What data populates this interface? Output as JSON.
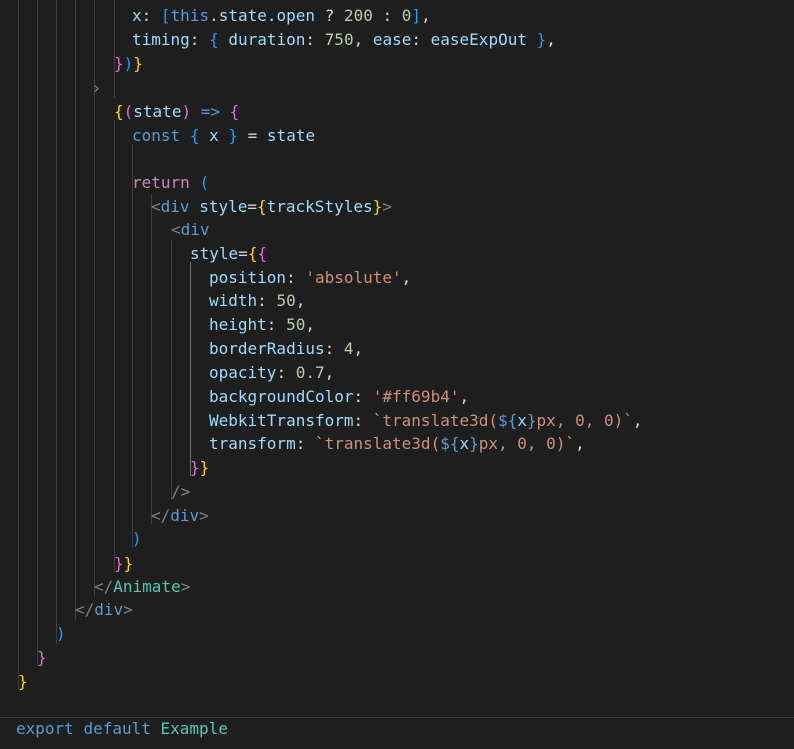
{
  "editor": {
    "language": "javascript-react",
    "theme_colors": {
      "background": "#1e1e1e",
      "default": "#d4d4d4",
      "variable": "#9cdcfe",
      "keyword": "#569cd6",
      "control": "#c586c0",
      "number": "#b5cea8",
      "string": "#ce9178",
      "component": "#4ec9b0",
      "bracket_gold": "#ffd700",
      "bracket_orchid": "#da70d6",
      "bracket_blue": "#179fff"
    },
    "fold_marker": "›",
    "lines": [
      {
        "tokens": [
          [
            "t-var",
            "x"
          ],
          [
            "t-default",
            ": "
          ],
          [
            "t-b3",
            "["
          ],
          [
            "t-kw",
            "this"
          ],
          [
            "t-default",
            "."
          ],
          [
            "t-var",
            "state"
          ],
          [
            "t-default",
            "."
          ],
          [
            "t-var",
            "open"
          ],
          [
            "t-default",
            " ? "
          ],
          [
            "t-num",
            "200"
          ],
          [
            "t-default",
            " : "
          ],
          [
            "t-num",
            "0"
          ],
          [
            "t-b3",
            "]"
          ],
          [
            "t-default",
            ","
          ]
        ]
      },
      {
        "tokens": [
          [
            "t-var",
            "timing"
          ],
          [
            "t-default",
            ": "
          ],
          [
            "t-b3",
            "{"
          ],
          [
            "t-default",
            " "
          ],
          [
            "t-var",
            "duration"
          ],
          [
            "t-default",
            ": "
          ],
          [
            "t-num",
            "750"
          ],
          [
            "t-default",
            ", "
          ],
          [
            "t-var",
            "ease"
          ],
          [
            "t-default",
            ": "
          ],
          [
            "t-var",
            "easeExpOut"
          ],
          [
            "t-default",
            " "
          ],
          [
            "t-b3",
            "}"
          ],
          [
            "t-default",
            ","
          ]
        ]
      },
      {
        "tokens": [
          [
            "t-b2",
            "}"
          ],
          [
            "t-b3",
            ")"
          ],
          [
            "t-b1",
            "}"
          ]
        ]
      },
      {
        "tokens": []
      },
      {
        "tokens": [
          [
            "t-b1",
            "{"
          ],
          [
            "t-b2",
            "("
          ],
          [
            "t-var",
            "state"
          ],
          [
            "t-b2",
            ")"
          ],
          [
            "t-default",
            " "
          ],
          [
            "t-kw",
            "=>"
          ],
          [
            "t-default",
            " "
          ],
          [
            "t-b2",
            "{"
          ]
        ]
      },
      {
        "tokens": [
          [
            "t-kw",
            "const"
          ],
          [
            "t-default",
            " "
          ],
          [
            "t-b3",
            "{"
          ],
          [
            "t-default",
            " "
          ],
          [
            "t-var",
            "x"
          ],
          [
            "t-default",
            " "
          ],
          [
            "t-b3",
            "}"
          ],
          [
            "t-default",
            " = "
          ],
          [
            "t-var",
            "state"
          ]
        ]
      },
      {
        "tokens": []
      },
      {
        "tokens": [
          [
            "t-ctl",
            "return"
          ],
          [
            "t-default",
            " "
          ],
          [
            "t-b3",
            "("
          ]
        ]
      },
      {
        "tokens": [
          [
            "t-punc",
            "<"
          ],
          [
            "t-tag",
            "div"
          ],
          [
            "t-default",
            " "
          ],
          [
            "t-var",
            "style"
          ],
          [
            "t-default",
            "="
          ],
          [
            "t-b1",
            "{"
          ],
          [
            "t-var",
            "trackStyles"
          ],
          [
            "t-b1",
            "}"
          ],
          [
            "t-punc",
            ">"
          ]
        ]
      },
      {
        "tokens": [
          [
            "t-punc",
            "<"
          ],
          [
            "t-tag",
            "div"
          ]
        ]
      },
      {
        "tokens": [
          [
            "t-var",
            "style"
          ],
          [
            "t-default",
            "="
          ],
          [
            "t-b1",
            "{"
          ],
          [
            "t-b2",
            "{"
          ]
        ]
      },
      {
        "tokens": [
          [
            "t-var",
            "position"
          ],
          [
            "t-default",
            ": "
          ],
          [
            "t-str",
            "'absolute'"
          ],
          [
            "t-default",
            ","
          ]
        ]
      },
      {
        "tokens": [
          [
            "t-var",
            "width"
          ],
          [
            "t-default",
            ": "
          ],
          [
            "t-num",
            "50"
          ],
          [
            "t-default",
            ","
          ]
        ]
      },
      {
        "tokens": [
          [
            "t-var",
            "height"
          ],
          [
            "t-default",
            ": "
          ],
          [
            "t-num",
            "50"
          ],
          [
            "t-default",
            ","
          ]
        ]
      },
      {
        "tokens": [
          [
            "t-var",
            "borderRadius"
          ],
          [
            "t-default",
            ": "
          ],
          [
            "t-num",
            "4"
          ],
          [
            "t-default",
            ","
          ]
        ]
      },
      {
        "tokens": [
          [
            "t-var",
            "opacity"
          ],
          [
            "t-default",
            ": "
          ],
          [
            "t-num",
            "0.7"
          ],
          [
            "t-default",
            ","
          ]
        ]
      },
      {
        "tokens": [
          [
            "t-var",
            "backgroundColor"
          ],
          [
            "t-default",
            ": "
          ],
          [
            "t-str",
            "'#ff69b4'"
          ],
          [
            "t-default",
            ","
          ]
        ]
      },
      {
        "tokens": [
          [
            "t-var",
            "WebkitTransform"
          ],
          [
            "t-default",
            ": "
          ],
          [
            "t-str",
            "`translate3d("
          ],
          [
            "t-kw",
            "${"
          ],
          [
            "t-var",
            "x"
          ],
          [
            "t-kw",
            "}"
          ],
          [
            "t-str",
            "px, 0, 0)`"
          ],
          [
            "t-default",
            ","
          ]
        ]
      },
      {
        "tokens": [
          [
            "t-var",
            "transform"
          ],
          [
            "t-default",
            ": "
          ],
          [
            "t-str",
            "`translate3d("
          ],
          [
            "t-kw",
            "${"
          ],
          [
            "t-var",
            "x"
          ],
          [
            "t-kw",
            "}"
          ],
          [
            "t-str",
            "px, 0, 0)`"
          ],
          [
            "t-default",
            ","
          ]
        ]
      },
      {
        "tokens": [
          [
            "t-b2",
            "}"
          ],
          [
            "t-b1",
            "}"
          ]
        ]
      },
      {
        "tokens": [
          [
            "t-punc",
            "/>"
          ]
        ]
      },
      {
        "tokens": [
          [
            "t-punc",
            "</"
          ],
          [
            "t-tag",
            "div"
          ],
          [
            "t-punc",
            ">"
          ]
        ]
      },
      {
        "tokens": [
          [
            "t-b3",
            ")"
          ]
        ]
      },
      {
        "tokens": [
          [
            "t-b2",
            "}"
          ],
          [
            "t-b1",
            "}"
          ]
        ]
      },
      {
        "tokens": [
          [
            "t-punc",
            "</"
          ],
          [
            "t-comp",
            "Animate"
          ],
          [
            "t-punc",
            ">"
          ]
        ]
      },
      {
        "tokens": [
          [
            "t-punc",
            "</"
          ],
          [
            "t-tag",
            "div"
          ],
          [
            "t-punc",
            ">"
          ]
        ]
      },
      {
        "tokens": [
          [
            "t-b3",
            ")"
          ]
        ]
      },
      {
        "tokens": [
          [
            "t-b2",
            "}"
          ]
        ]
      },
      {
        "tokens": [
          [
            "t-b1",
            "}"
          ]
        ]
      },
      {
        "tokens": []
      },
      {
        "tokens": [
          [
            "t-kw",
            "export"
          ],
          [
            "t-default",
            " "
          ],
          [
            "t-kw",
            "default"
          ],
          [
            "t-default",
            " "
          ],
          [
            "t-comp",
            "Example"
          ]
        ]
      }
    ]
  }
}
